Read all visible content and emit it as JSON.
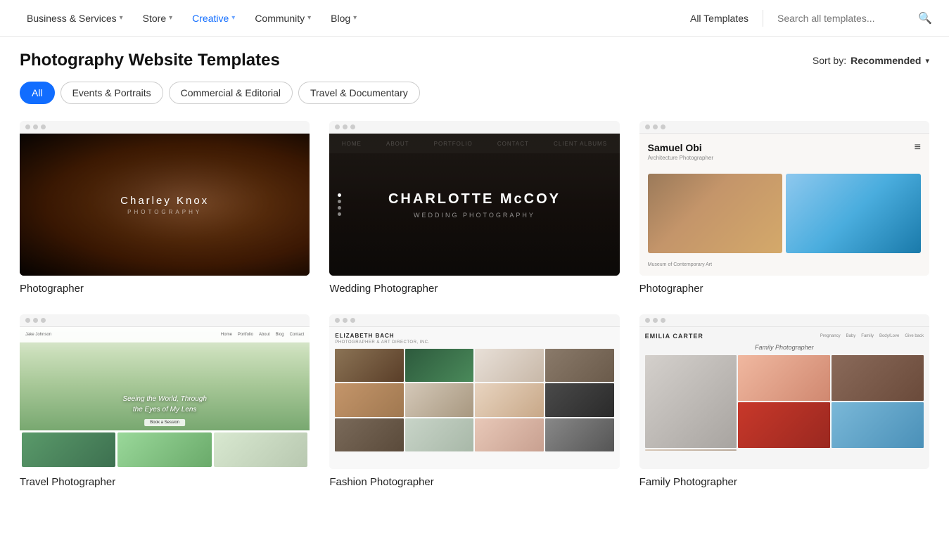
{
  "nav": {
    "items": [
      {
        "label": "Business & Services",
        "active": false,
        "hasChevron": true
      },
      {
        "label": "Store",
        "active": false,
        "hasChevron": true
      },
      {
        "label": "Creative",
        "active": true,
        "hasChevron": true
      },
      {
        "label": "Community",
        "active": false,
        "hasChevron": true
      },
      {
        "label": "Blog",
        "active": false,
        "hasChevron": true
      }
    ],
    "allTemplates": "All Templates",
    "searchPlaceholder": "Search all templates...",
    "colors": {
      "active": "#116dff"
    }
  },
  "page": {
    "title": "Photography Website Templates",
    "sortBy": "Sort by:",
    "sortValue": "Recommended"
  },
  "filters": [
    {
      "label": "All",
      "active": true
    },
    {
      "label": "Events & Portraits",
      "active": false
    },
    {
      "label": "Commercial & Editorial",
      "active": false
    },
    {
      "label": "Travel & Documentary",
      "active": false
    }
  ],
  "templates": [
    {
      "name": "Photographer",
      "thumb": "charley"
    },
    {
      "name": "Wedding Photographer",
      "thumb": "charlotte"
    },
    {
      "name": "Photographer",
      "thumb": "samuel"
    },
    {
      "name": "Travel Photographer",
      "thumb": "travel"
    },
    {
      "name": "Fashion Photographer",
      "thumb": "fashion"
    },
    {
      "name": "Family Photographer",
      "thumb": "family"
    }
  ]
}
